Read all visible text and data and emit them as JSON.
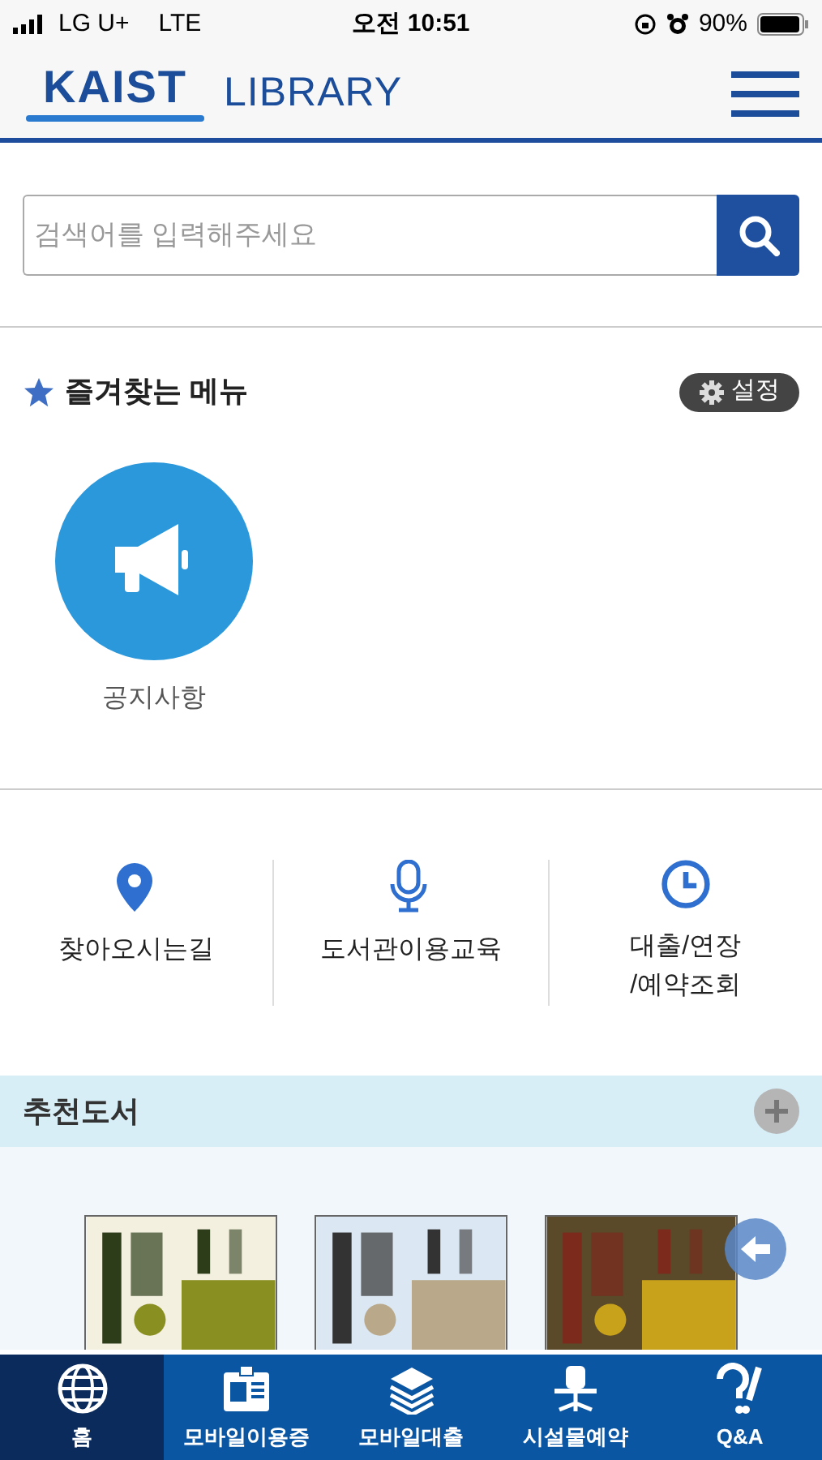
{
  "status_bar": {
    "carrier": "LG U+",
    "network": "LTE",
    "time": "오전 10:51",
    "battery": "90%"
  },
  "header": {
    "logo": "KAIST",
    "title": "LIBRARY"
  },
  "search": {
    "placeholder": "검색어를 입력해주세요"
  },
  "favorites": {
    "title": "즐겨찾는 메뉴",
    "settings": "설정",
    "items": [
      {
        "label": "공지사항"
      }
    ]
  },
  "quick_links": [
    {
      "label": "찾아오시는길"
    },
    {
      "label": "도서관이용교육"
    },
    {
      "label": "대출/연장\n/예약조회"
    }
  ],
  "recommended": {
    "title": "추천도서"
  },
  "bottom_nav": [
    {
      "label": "홈",
      "selected": true
    },
    {
      "label": "모바일이용증",
      "selected": false
    },
    {
      "label": "모바일대출",
      "selected": false
    },
    {
      "label": "시설물예약",
      "selected": false
    },
    {
      "label": "Q&A",
      "selected": false
    }
  ]
}
